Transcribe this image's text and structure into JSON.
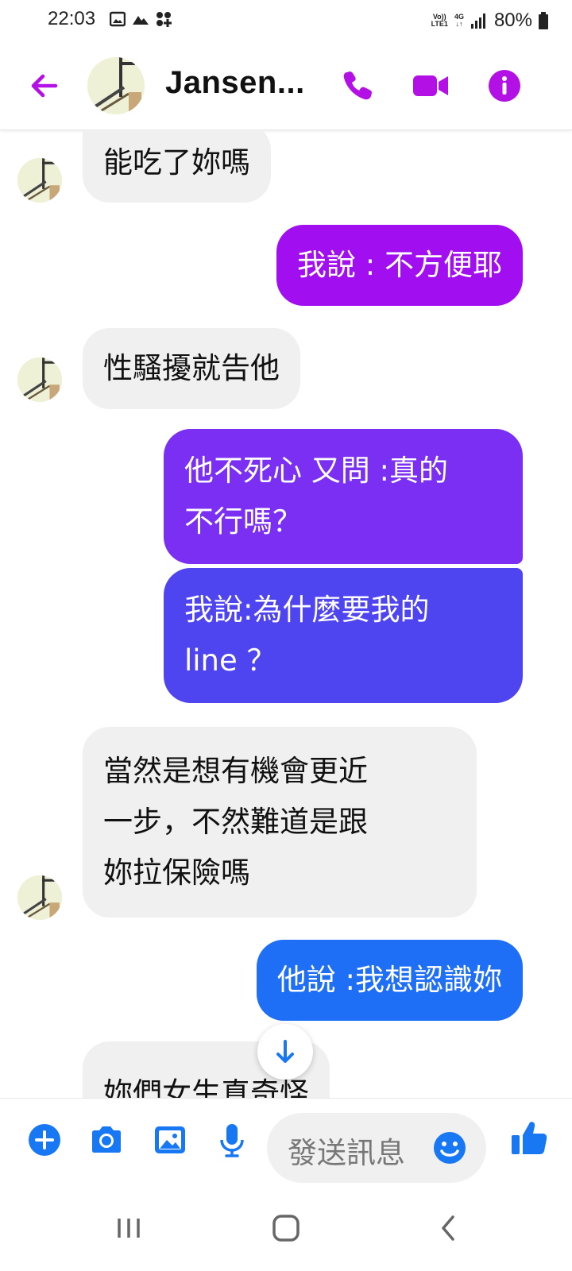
{
  "status_bar": {
    "time": "22:03",
    "network_top": "Vo))",
    "network_bottom": "LTE1",
    "network_type": "4G",
    "battery": "80%"
  },
  "header": {
    "contact_name": "Jansen...",
    "accent_color": "#b310e6"
  },
  "messages": [
    {
      "direction": "incoming",
      "lines": [
        "能吃了妳嗎"
      ]
    },
    {
      "direction": "outgoing",
      "lines": [
        "我說 : 不方便耶"
      ],
      "color": "#a10ff0"
    },
    {
      "direction": "incoming",
      "lines": [
        "性騷擾就告他"
      ]
    },
    {
      "direction": "outgoing",
      "lines": [
        "他不死心 又問 :真的",
        "不行嗎？"
      ],
      "color": "#7a2ff2"
    },
    {
      "direction": "outgoing",
      "lines": [
        "我說:為什麼要我的",
        "line ？"
      ],
      "color": "#4f45f0"
    },
    {
      "direction": "incoming",
      "lines": [
        "當然是想有機會更近",
        "一步，不然難道是跟",
        "妳拉保險嗎"
      ]
    },
    {
      "direction": "outgoing",
      "lines": [
        "他說 :我想認識妳"
      ],
      "color": "#1e6ff5"
    },
    {
      "direction": "incoming",
      "lines": [
        "妳們女生真奇怪"
      ]
    }
  ],
  "composer": {
    "placeholder": "發送訊息",
    "icon_color": "#1877f2"
  },
  "icons": {
    "back": "arrow-left-icon",
    "call": "phone-icon",
    "video": "video-camera-icon",
    "info": "info-icon",
    "add": "plus-circle-icon",
    "camera": "camera-icon",
    "gallery": "image-icon",
    "mic": "microphone-icon",
    "emoji": "smiley-icon",
    "like": "thumbs-up-icon",
    "scroll": "arrow-down-icon"
  }
}
